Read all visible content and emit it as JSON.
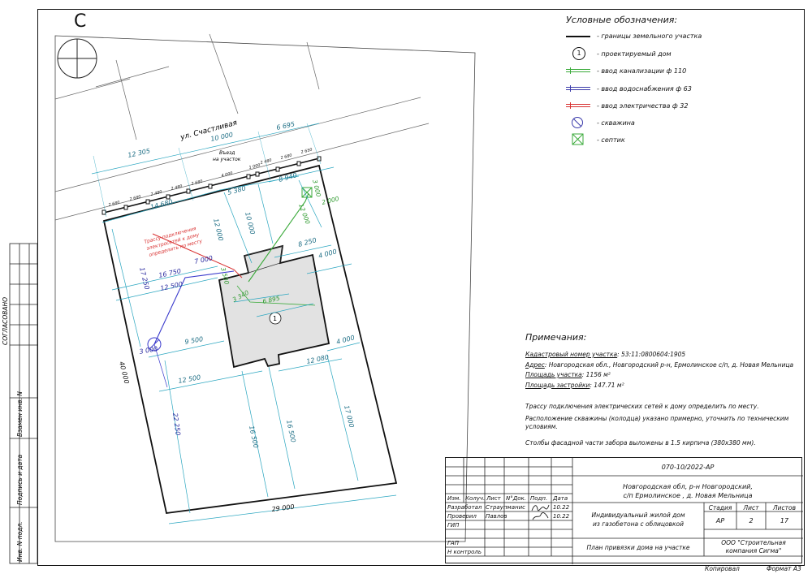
{
  "sheet_letter": "С",
  "side": {
    "agreed": "СОГЛАСОВАНО",
    "replaces": "Взамен инв. N",
    "sign_date": "Подпись и дата",
    "inv_orig": "Инв. N подл."
  },
  "legend": {
    "title": "Условные обозначения:",
    "items": [
      {
        "icon": "plot-boundary-line",
        "color": "#111111",
        "label": "- границы земельного участка"
      },
      {
        "icon": "house-number-circle",
        "symbol": "1",
        "label": "- проектируемый дом"
      },
      {
        "icon": "sewer-line",
        "color": "#3aaa3a",
        "label": "- ввод канализации ф 110"
      },
      {
        "icon": "water-line",
        "color": "#3a3aaa",
        "label": "- ввод водоснабжения ф 63"
      },
      {
        "icon": "power-line",
        "color": "#d83030",
        "label": "- ввод электричества ф 32"
      },
      {
        "icon": "well-circle",
        "color": "#3a3aaa",
        "label": "- скважина"
      },
      {
        "icon": "septic-box",
        "color": "#3aaa3a",
        "label": "- септик"
      }
    ]
  },
  "plan": {
    "street": "ул. Счастливая",
    "entry_label_1": "Въезд",
    "entry_label_2": "на участок",
    "power_note_1": "Трассу подключения",
    "power_note_2": "электросетей к дому",
    "power_note_3": "определить по месту",
    "house_number": "1",
    "dims": {
      "d12305": "12 305",
      "d10000": "10 000",
      "d6695": "6 695",
      "d14680": "14 680",
      "d5380": "5 380",
      "d8940": "8 940",
      "d3000a": "3 000",
      "d2000": "2 000",
      "d12000a": "12 000",
      "d10000b": "10 000",
      "d12000b": "12 000",
      "d17250": "17 250",
      "d7000": "7 000",
      "d16750": "16 750",
      "d12500a": "12 500",
      "d8250": "8 250",
      "d4000a": "4 000",
      "d3500": "3 500",
      "d3340": "3 340",
      "d6895": "6 895",
      "d9500": "9 500",
      "d3000b": "3 000",
      "d12080": "12 080",
      "d4000b": "4 000",
      "d12500b": "12 500",
      "d40000": "40 000",
      "d22250": "22 250",
      "d16500a": "16 500",
      "d16500b": "16 500",
      "d17000": "17 000",
      "d29000": "29 000",
      "fence": [
        "2 680",
        "2 680",
        "2 480",
        "2 480",
        "2 680",
        "4 000",
        "1 000",
        "2 480",
        "2 680",
        "2 650"
      ]
    }
  },
  "notes": {
    "title": "Примечания:",
    "cadastral_label": "Кадастровый номер участка",
    "cadastral_value": ": 53:11:0800604:1905",
    "address_label": "Адрес",
    "address_value": ": Новгородская обл., Новгородский р-н, Ермолинское с/п, д. Новая Мельница",
    "area_label": "Площадь участка",
    "area_value": ": 1156 м²",
    "building_label": "Площадь застройки",
    "building_value": ": 147.71 м²",
    "p1": "Трассу подключения электрических сетей к дому определить по месту.",
    "p2": "Расположение скважины (колодца) указано примерно, уточнить по техническим условиям.",
    "p3": "Столбы фасадной части забора выложены в 1.5 кирпича (380х380 мм)."
  },
  "stamp": {
    "code": "070-10/2022-АР",
    "location_1": "Новгородская обл, р-н Новгородский,",
    "location_2": "с/п Ермолинское , д. Новая Мельница",
    "h_izm": "Изм.",
    "h_koluch": "Колуч.",
    "h_list": "Лист",
    "h_ndok": "N°Док.",
    "h_podp": "Подп.",
    "h_data": "Дата",
    "r1_role": "Разработал",
    "r1_name": "Страупманис",
    "r1_date": "10.22",
    "r2_role": "Проверил",
    "r2_name": "Павлов",
    "r2_date": "10.22",
    "r3_role": "ГИП",
    "r4_role": "ГАП",
    "r5_role": "Н контроль",
    "object_1": "Индивидуальный жилой дом",
    "object_2": "из газобетона с облицовкой",
    "h_stage": "Стадия",
    "h_sheet": "Лист",
    "h_sheets": "Листов",
    "stage": "АР",
    "sheet": "2",
    "sheets": "17",
    "drawing": "План привязки дома на участке",
    "company_1": "ООО \"Строительная",
    "company_2": "компания Сигма\"",
    "copied": "Копировал",
    "format": "Формат А3"
  }
}
